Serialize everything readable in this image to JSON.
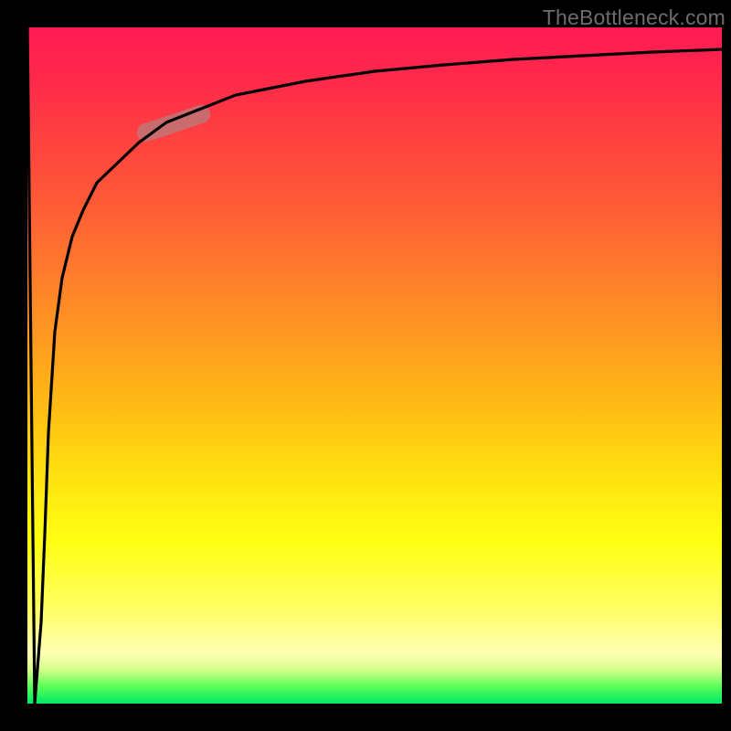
{
  "watermark": {
    "text": "TheBottleneck.com"
  },
  "colors": {
    "bg": "#000000",
    "watermark": "#6d6d6d",
    "gradient_top": "#ff1a54",
    "gradient_mid": "#ffff12",
    "gradient_bottom": "#00e864",
    "curve": "#000000",
    "highlight": "#bb7a7a"
  },
  "chart_data": {
    "type": "line",
    "title": "",
    "xlabel": "",
    "ylabel": "",
    "xlim": [
      0,
      100
    ],
    "ylim": [
      0,
      100
    ],
    "grid": false,
    "notes": "Background gradient encodes a secondary scale from ~100 (red, top) to ~0 (green, bottom). A salmon pill-shaped highlight marks a short segment of the curve near x≈20, y≈86.",
    "series": [
      {
        "name": "bottleneck-curve",
        "x": [
          0,
          1,
          2,
          2.5,
          3,
          4,
          5,
          6.5,
          8,
          10,
          13,
          16,
          20,
          25,
          30,
          40,
          50,
          60,
          70,
          80,
          90,
          100
        ],
        "values": [
          100,
          0,
          12,
          25,
          40,
          55,
          63,
          69,
          73,
          77,
          80,
          83,
          86,
          88,
          90,
          92,
          93.5,
          94.5,
          95.2,
          95.8,
          96.3,
          96.7
        ]
      }
    ],
    "highlight_segment": {
      "x_start": 17,
      "x_end": 24,
      "y_approx": 86
    }
  }
}
